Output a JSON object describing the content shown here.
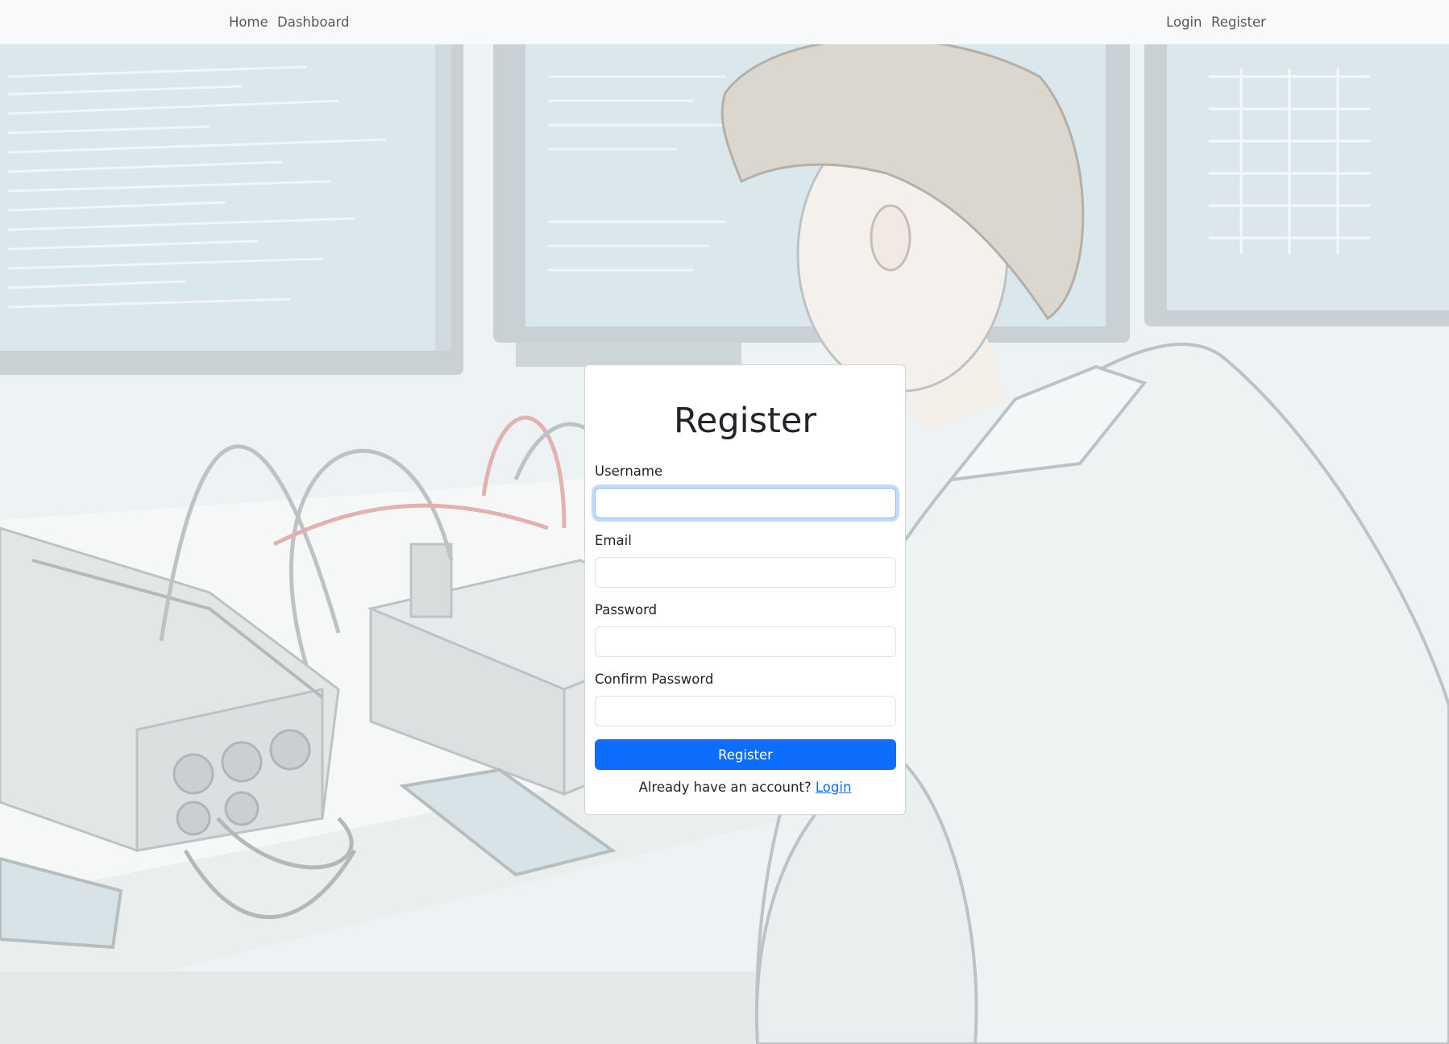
{
  "nav": {
    "left_links": [
      "Home",
      "Dashboard"
    ],
    "right_links": [
      "Login",
      "Register"
    ]
  },
  "form": {
    "title": "Register",
    "fields": [
      {
        "label": "Username",
        "value": "",
        "placeholder": ""
      },
      {
        "label": "Email",
        "value": "",
        "placeholder": ""
      },
      {
        "label": "Password",
        "value": "",
        "placeholder": ""
      },
      {
        "label": "Confirm Password",
        "value": "",
        "placeholder": ""
      }
    ],
    "submit_label": "Register",
    "footer_text": "Already have an account?",
    "footer_link": "Login"
  },
  "colors": {
    "navbar_bg": "#f8f9fa",
    "primary": "#0d6efd",
    "card_bg": "#ffffff",
    "text": "#212529"
  }
}
